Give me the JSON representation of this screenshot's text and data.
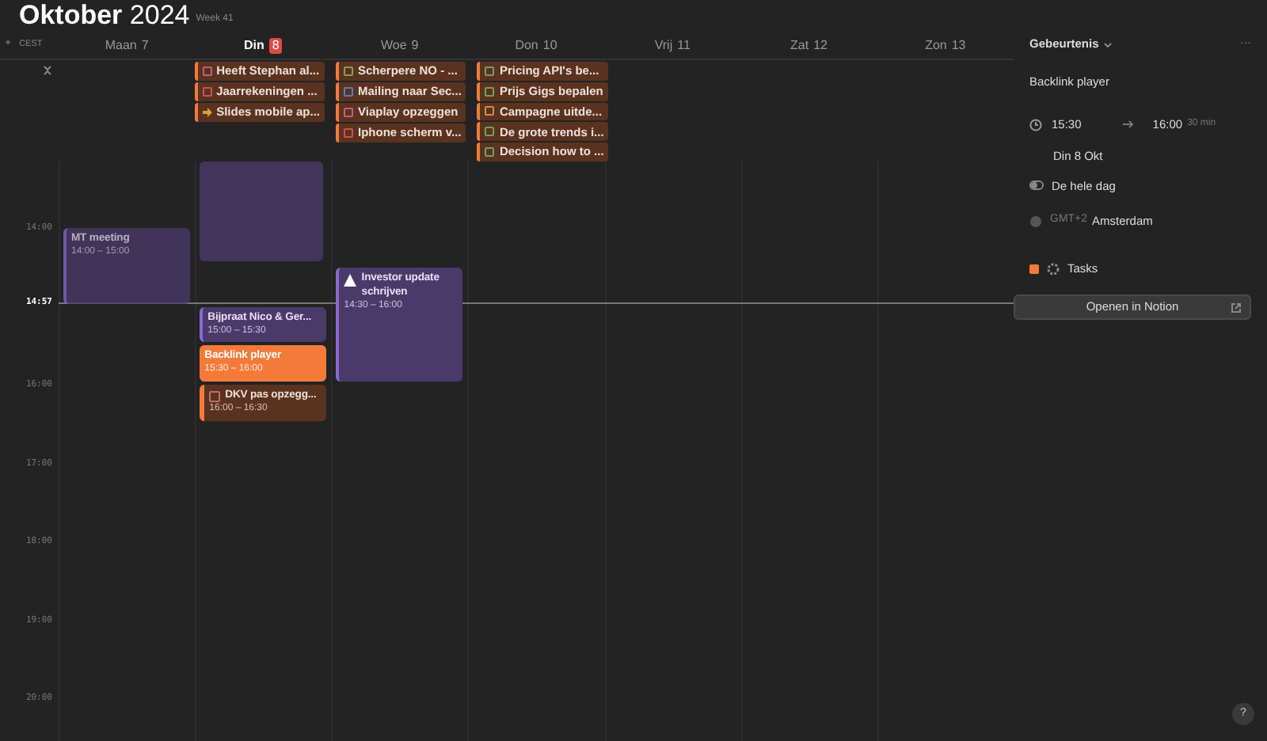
{
  "header": {
    "month": "Oktober",
    "year": "2024",
    "week": "Week 41",
    "add": "+",
    "timezone": "CEST"
  },
  "days": [
    {
      "name": "Maan",
      "date": "7",
      "today": false,
      "events": [
        {
          "kind": "event",
          "title": "MT meeting",
          "time": "14:00 – 15:00",
          "past": true,
          "selected": false,
          "warning": false
        }
      ]
    },
    {
      "name": "Din",
      "date": "8",
      "today": true,
      "all_day": [
        {
          "title": "Heeft Stephan al...",
          "kind": "checkbox",
          "color": "#c0607a"
        },
        {
          "title": "Jaarrekeningen ...",
          "kind": "checkbox",
          "color": "#d05050"
        },
        {
          "title": "Slides mobile ap...",
          "kind": "arrow",
          "color": "#e0a030"
        }
      ],
      "events": [
        {
          "kind": "event",
          "title": "Bijpraat Nico & Ger...",
          "time": "15:00 – 15:30",
          "past": false,
          "selected": false,
          "warning": false
        },
        {
          "kind": "event",
          "title": "Backlink player",
          "time": "15:30 – 16:00",
          "past": false,
          "selected": true,
          "warning": false
        },
        {
          "kind": "task",
          "title": "DKV pas opzegg...",
          "time": "16:00 – 16:30",
          "past": false,
          "selected": false,
          "warning": false
        }
      ]
    },
    {
      "name": "Woe",
      "date": "9",
      "today": false,
      "all_day": [
        {
          "title": "Scherpere NO - ...",
          "kind": "checkbox",
          "color": "#80a060"
        },
        {
          "title": "Mailing naar Sec...",
          "kind": "checkbox",
          "color": "#5080c0"
        },
        {
          "title": "Viaplay opzeggen",
          "kind": "checkbox",
          "color": "#c06080"
        },
        {
          "title": "Iphone scherm v...",
          "kind": "checkbox",
          "color": "#d05050"
        }
      ],
      "events": [
        {
          "kind": "event",
          "title": "Investor update schrijven",
          "time": "14:30 – 16:00",
          "past": false,
          "selected": false,
          "warning": true
        }
      ]
    },
    {
      "name": "Don",
      "date": "10",
      "today": false,
      "all_day": [
        {
          "title": "Pricing API's be...",
          "kind": "checkbox",
          "color": "#70a060"
        },
        {
          "title": "Prijs Gigs bepalen",
          "kind": "checkbox",
          "color": "#70a060"
        },
        {
          "title": "Campagne uitde...",
          "kind": "checkbox",
          "color": "#d09040"
        },
        {
          "title": "De grote trends i...",
          "kind": "checkbox",
          "color": "#70a060"
        },
        {
          "title": "Decision how to ...",
          "kind": "checkbox",
          "color": "#70a060"
        }
      ]
    },
    {
      "name": "Vrij",
      "date": "11",
      "today": false
    },
    {
      "name": "Zat",
      "date": "12",
      "today": false
    },
    {
      "name": "Zon",
      "date": "13",
      "today": false
    }
  ],
  "hour_labels": [
    "14:00",
    "16:00",
    "17:00",
    "18:00",
    "19:00",
    "20:00"
  ],
  "current_time": "14:57",
  "panel": {
    "type": "Gebeurtenis",
    "more": "···",
    "title": "Backlink player",
    "start": "15:30",
    "end": "16:00",
    "duration": "30 min",
    "date": "Din 8 Okt",
    "all_day": {
      "label": "De hele dag",
      "on": false
    },
    "offset": "GMT+2",
    "zone": "Amsterdam",
    "calendar": {
      "name": "Tasks",
      "color": "#f47a3a"
    },
    "open_button": "Openen in Notion"
  },
  "help": "?"
}
